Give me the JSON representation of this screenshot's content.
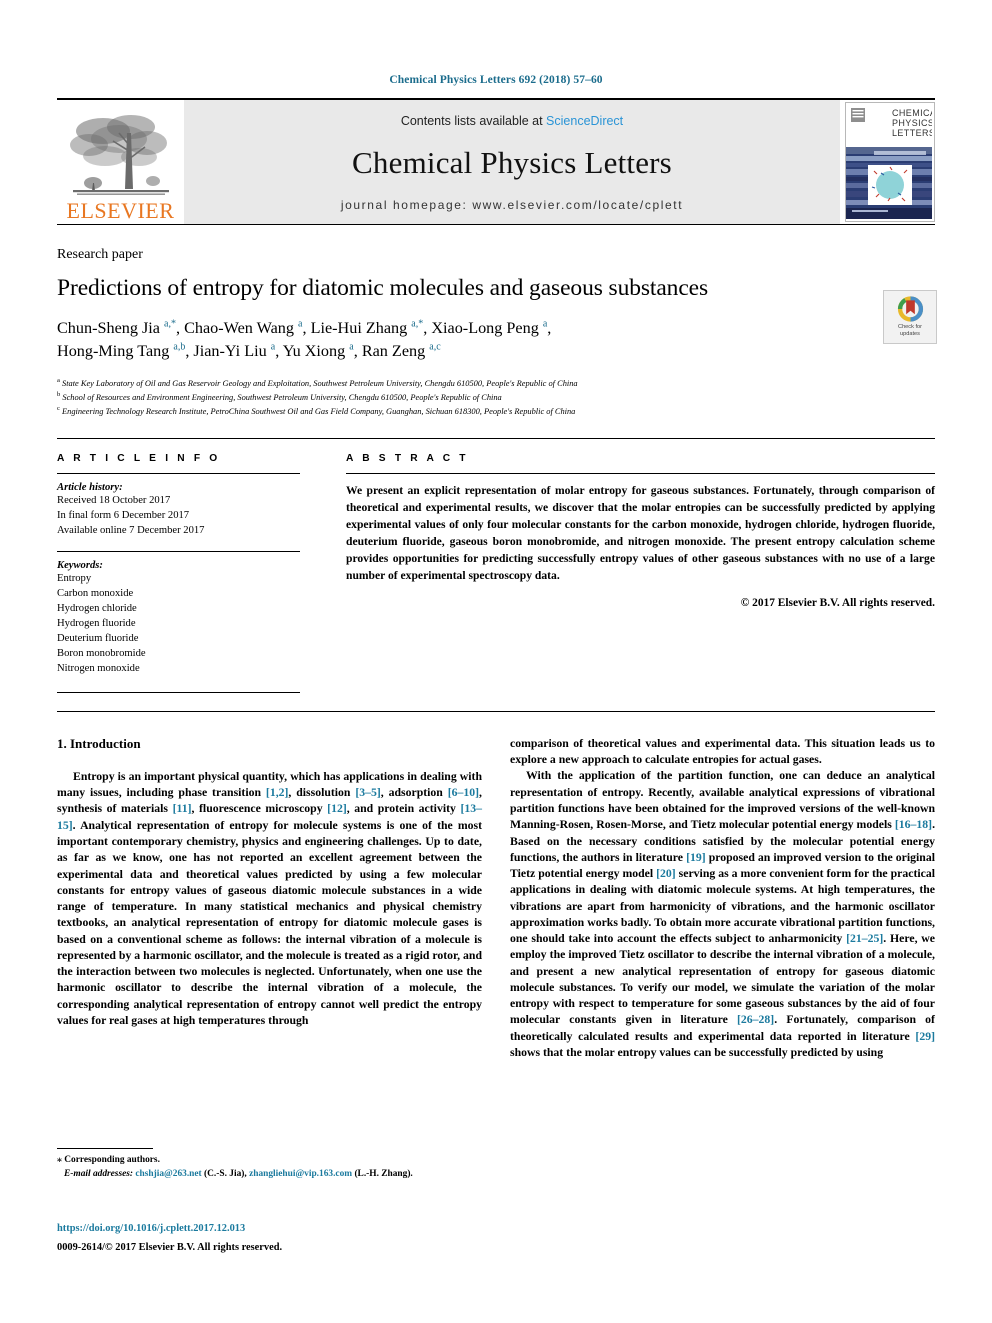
{
  "running_head": "Chemical Physics Letters 692 (2018) 57–60",
  "masthead": {
    "publisher_name": "ELSEVIER",
    "contents_prefix": "Contents lists available at ",
    "sciencedirect": "ScienceDirect",
    "journal_name": "Chemical Physics Letters",
    "homepage": "journal homepage: www.elsevier.com/locate/cplett",
    "cover_title_line1": "CHEMICAL",
    "cover_title_line2": "PHYSICS",
    "cover_title_line3": "LETTERS"
  },
  "article": {
    "paper_type": "Research paper",
    "title": "Predictions of entropy for diatomic molecules and gaseous substances",
    "authors_line1": "Chun-Sheng Jia a,*, Chao-Wen Wang a, Lie-Hui Zhang a,*, Xiao-Long Peng a,",
    "authors_line2": "Hong-Ming Tang a,b, Jian-Yi Liu a, Yu Xiong a, Ran Zeng a,c",
    "affiliation_a": "State Key Laboratory of Oil and Gas Reservoir Geology and Exploitation, Southwest Petroleum University, Chengdu 610500, People's Republic of China",
    "affiliation_b": "School of Resources and Environment Engineering, Southwest Petroleum University, Chengdu 610500, People's Republic of China",
    "affiliation_c": "Engineering Technology Research Institute, PetroChina Southwest Oil and Gas Field Company, Guanghan, Sichuan 618300, People's Republic of China",
    "crossmark_label_line1": "Check for",
    "crossmark_label_line2": "updates"
  },
  "article_info": {
    "heading": "A R T I C L E  I N F O",
    "history_label": "Article history:",
    "history": [
      "Received 18 October 2017",
      "In final form 6 December 2017",
      "Available online 7 December 2017"
    ],
    "keywords_label": "Keywords:",
    "keywords": [
      "Entropy",
      "Carbon monoxide",
      "Hydrogen chloride",
      "Hydrogen fluoride",
      "Deuterium fluoride",
      "Boron monobromide",
      "Nitrogen monoxide"
    ]
  },
  "abstract": {
    "heading": "A B S T R A C T",
    "text": "We present an explicit representation of molar entropy for gaseous substances. Fortunately, through comparison of theoretical and experimental results, we discover that the molar entropies can be successfully predicted by applying experimental values of only four molecular constants for the carbon monoxide, hydrogen chloride, hydrogen fluoride, deuterium fluoride, gaseous boron monobromide, and nitrogen monoxide. The present entropy calculation scheme provides opportunities for predicting successfully entropy values of other gaseous substances with no use of a large number of experimental spectroscopy data.",
    "copyright": "© 2017 Elsevier B.V. All rights reserved."
  },
  "body": {
    "section_title": "1. Introduction",
    "left_paragraph_segments": [
      {
        "t": "Entropy is an important physical quantity, which has applications in dealing with many issues, including phase transition "
      },
      {
        "t": "[1,2]",
        "ref": true
      },
      {
        "t": ", dissolution "
      },
      {
        "t": "[3–5]",
        "ref": true
      },
      {
        "t": ", adsorption "
      },
      {
        "t": "[6–10]",
        "ref": true
      },
      {
        "t": ", synthesis of materials "
      },
      {
        "t": "[11]",
        "ref": true
      },
      {
        "t": ", fluorescence microscopy "
      },
      {
        "t": "[12]",
        "ref": true
      },
      {
        "t": ", and protein activity "
      },
      {
        "t": "[13–15]",
        "ref": true
      },
      {
        "t": ". Analytical representation of entropy for molecule systems is one of the most important contemporary chemistry, physics and engineering challenges. Up to date, as far as we know, one has not reported an excellent agreement between the experimental data and theoretical values predicted by using a few molecular constants for entropy values of gaseous diatomic molecule substances in a wide range of temperature. In many statistical mechanics and physical chemistry textbooks, an analytical representation of entropy for diatomic molecule gases is based on a conventional scheme as follows: the internal vibration of a molecule is represented by a harmonic oscillator, and the molecule is treated as a rigid rotor, and the interaction between two molecules is neglected. Unfortunately, when one use the harmonic oscillator to describe the internal vibration of a molecule, the corresponding analytical representation of entropy cannot well predict the entropy values for real gases at high temperatures through"
      }
    ],
    "right_paragraph1_segments": [
      {
        "t": "comparison of theoretical values and experimental data. This situation leads us to explore a new approach to calculate entropies for actual gases."
      }
    ],
    "right_paragraph2_segments": [
      {
        "t": "With the application of the partition function, one can deduce an analytical representation of entropy. Recently, available analytical expressions of vibrational partition functions have been obtained for the improved versions of the well-known Manning-Rosen, Rosen-Morse, and Tietz molecular potential energy models "
      },
      {
        "t": "[16–18]",
        "ref": true
      },
      {
        "t": ". Based on the necessary conditions satisfied by the molecular potential energy functions, the authors in literature "
      },
      {
        "t": "[19]",
        "ref": true
      },
      {
        "t": " proposed an improved version to the original Tietz potential energy model "
      },
      {
        "t": "[20]",
        "ref": true
      },
      {
        "t": " serving as a more convenient form for the practical applications in dealing with diatomic molecule systems. At high temperatures, the vibrations are apart from harmonicity of vibrations, and the harmonic oscillator approximation works badly. To obtain more accurate vibrational partition functions, one should take into account the effects subject to anharmonicity "
      },
      {
        "t": "[21–25]",
        "ref": true
      },
      {
        "t": ". Here, we employ the improved Tietz oscillator to describe the internal vibration of a molecule, and present a new analytical representation of entropy for gaseous diatomic molecule substances. To verify our model, we simulate the variation of the molar entropy with respect to temperature for some gaseous substances by the aid of four molecular constants given in literature "
      },
      {
        "t": "[26–28]",
        "ref": true
      },
      {
        "t": ". Fortunately, comparison of theoretically calculated results and experimental data reported in literature "
      },
      {
        "t": "[29]",
        "ref": true
      },
      {
        "t": " shows that the molar entropy values can be successfully predicted by using"
      }
    ]
  },
  "footnotes": {
    "corresponding": "⁎ Corresponding authors.",
    "email_label": "E-mail addresses:",
    "email1": "chshjia@263.net",
    "email1_owner": "(C.-S. Jia)",
    "email2": "zhangliehui@vip.163.com",
    "email2_owner": "(L.-H. Zhang)."
  },
  "doi": {
    "link": "https://doi.org/10.1016/j.cplett.2017.12.013",
    "issn_line": "0009-2614/© 2017 Elsevier B.V. All rights reserved."
  },
  "colors": {
    "link": "#1b7a9e",
    "running_head": "#1b6c8c",
    "sciencedirect": "#2a94d6",
    "elsevier_orange": "#E87722",
    "masthead_bg": "#e9e9e9"
  }
}
